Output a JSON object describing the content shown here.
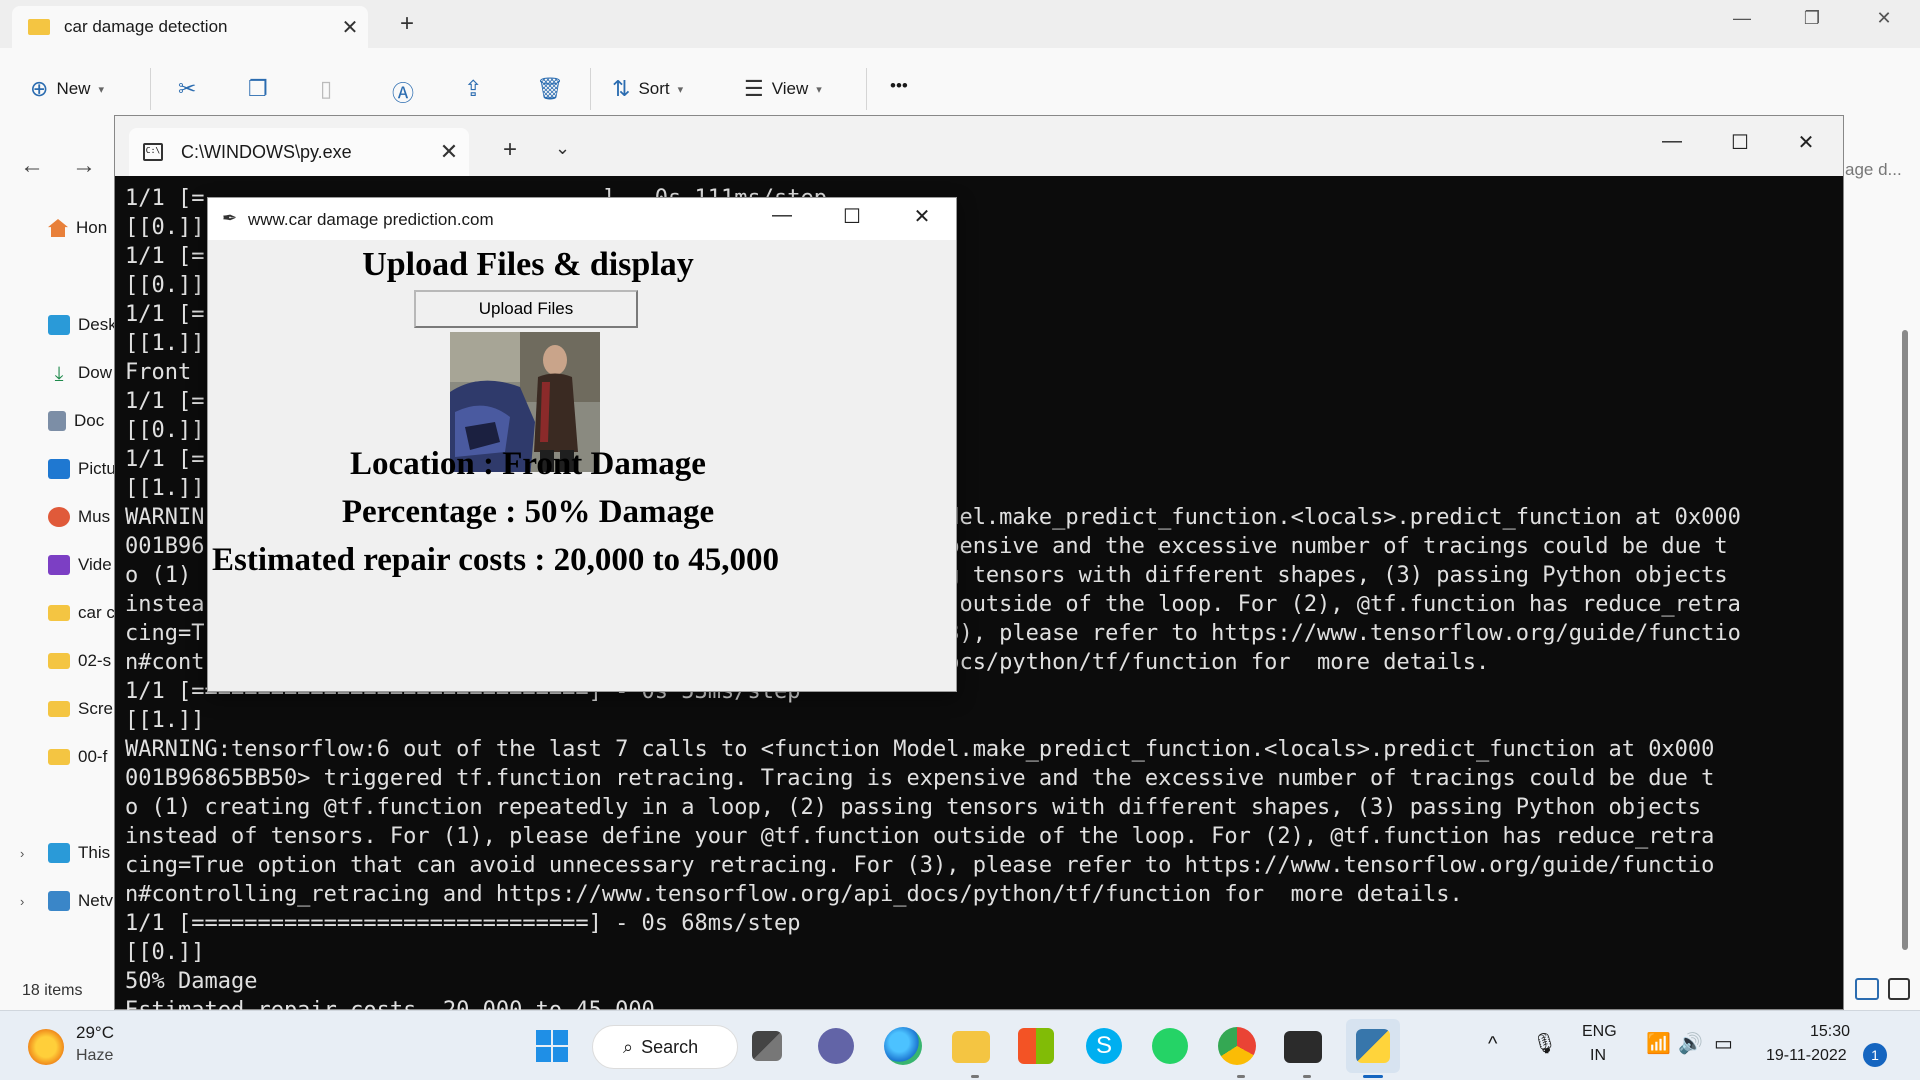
{
  "explorer": {
    "tab_title": "car damage detection",
    "toolbar": {
      "new_label": "New",
      "sort_label": "Sort",
      "view_label": "View",
      "more_label": "•••"
    },
    "search_tail": "age d...",
    "sidebar": [
      {
        "label": "Hon",
        "icon": "home-icon"
      },
      {
        "label": "Desk",
        "icon": "desktop-icon"
      },
      {
        "label": "Dow",
        "icon": "download-icon"
      },
      {
        "label": "Doc",
        "icon": "document-icon"
      },
      {
        "label": "Pictu",
        "icon": "pictures-icon"
      },
      {
        "label": "Mus",
        "icon": "music-icon"
      },
      {
        "label": "Vide",
        "icon": "videos-icon"
      },
      {
        "label": "car c",
        "icon": "folder-icon"
      },
      {
        "label": "02-s",
        "icon": "folder-icon"
      },
      {
        "label": "Scre",
        "icon": "folder-icon"
      },
      {
        "label": "00-f",
        "icon": "folder-icon"
      },
      {
        "label": "This",
        "icon": "computer-icon"
      },
      {
        "label": "Netv",
        "icon": "network-icon"
      }
    ],
    "items_count": "18 items"
  },
  "terminal": {
    "tab_title": "C:\\WINDOWS\\py.exe",
    "lines": [
      "1/1 [=                              ] - 0s 111ms/step",
      "[[0.]]",
      "1/1 [=",
      "[[0.]]",
      "1/1 [=",
      "[[1.]]",
      "Front",
      "1/1 [=",
      "[[0.]]",
      "1/1 [=",
      "[[1.]]",
      "WARNIN                                                       odel.make_predict_function.<locals>.predict_function at 0x000",
      "001B96                                                       xpensive and the excessive number of tracings could be due t",
      "o (1)                                                        ng tensors with different shapes, (3) passing Python objects",
      "instea                                                       n outside of the loop. For (2), @tf.function has reduce_retra",
      "cing=T                                                       (3), please refer to https://www.tensorflow.org/guide/functio",
      "n#cont                                                       docs/python/tf/function for  more details.",
      "1/1 [==============================] - 0s 53ms/step",
      "[[1.]]",
      "WARNING:tensorflow:6 out of the last 7 calls to <function Model.make_predict_function.<locals>.predict_function at 0x000",
      "001B96865BB50> triggered tf.function retracing. Tracing is expensive and the excessive number of tracings could be due t",
      "o (1) creating @tf.function repeatedly in a loop, (2) passing tensors with different shapes, (3) passing Python objects",
      "instead of tensors. For (1), please define your @tf.function outside of the loop. For (2), @tf.function has reduce_retra",
      "cing=True option that can avoid unnecessary retracing. For (3), please refer to https://www.tensorflow.org/guide/functio",
      "n#controlling_retracing and https://www.tensorflow.org/api_docs/python/tf/function for  more details.",
      "1/1 [==============================] - 0s 68ms/step",
      "[[0.]]",
      "50% Damage",
      "Estimated repair costs  20,000 to 45,000"
    ]
  },
  "dialog": {
    "title": "www.car damage prediction.com",
    "heading": "Upload Files & display",
    "upload_button": "Upload Files",
    "location": "Location :  Front Damage",
    "percentage": "Percentage :  50% Damage",
    "repair": "Estimated repair costs :  20,000 to 45,000"
  },
  "taskbar": {
    "temperature": "29°C",
    "weather": "Haze",
    "search_label": "Search",
    "language_top": "ENG",
    "language_bottom": "IN",
    "time": "15:30",
    "date": "19-11-2022",
    "notifications": "1",
    "apps": [
      "start-icon",
      "search-icon",
      "task-view-icon",
      "teams-chat-icon",
      "edge-icon",
      "file-explorer-icon",
      "store-icon",
      "skype-icon",
      "whatsapp-icon",
      "chrome-icon",
      "terminal-icon",
      "python-icon"
    ]
  }
}
